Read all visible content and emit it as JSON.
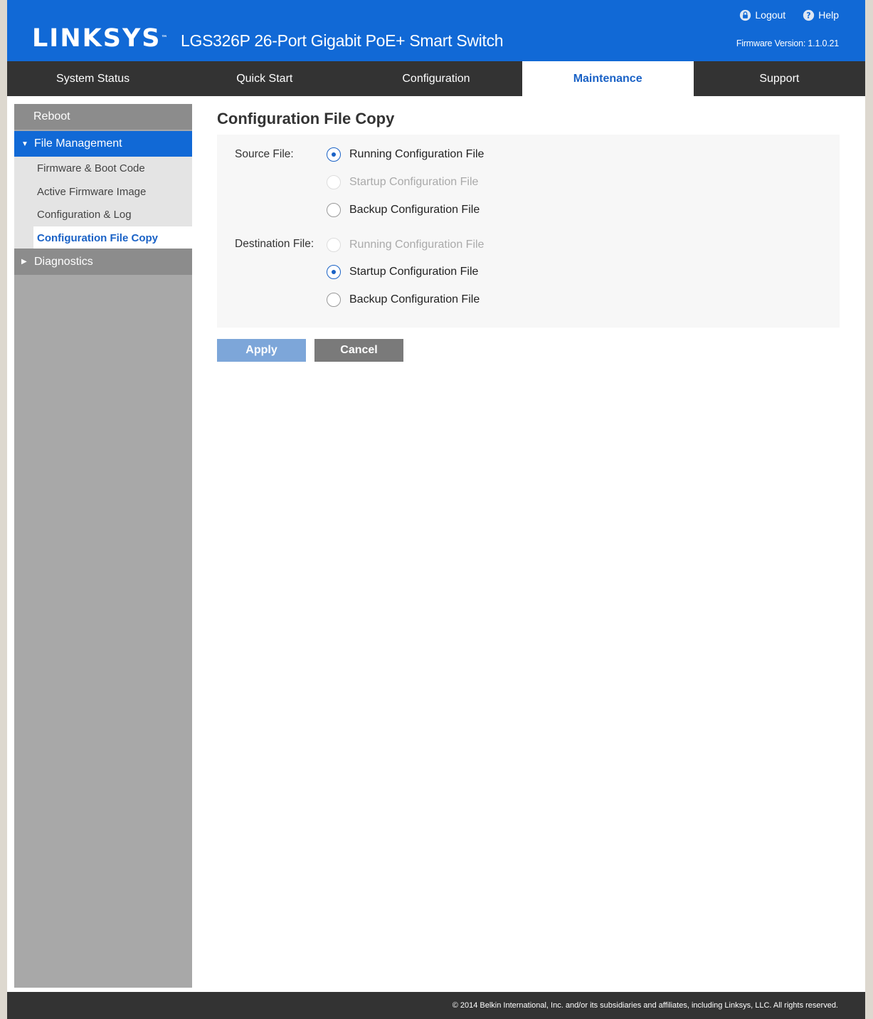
{
  "header": {
    "brand": "LINKSYS",
    "product_title": "LGS326P 26-Port Gigabit PoE+ Smart Switch",
    "logout_label": "Logout",
    "help_label": "Help",
    "firmware_label": "Firmware Version: 1.1.0.21"
  },
  "topnav": {
    "items": [
      {
        "label": "System Status"
      },
      {
        "label": "Quick Start"
      },
      {
        "label": "Configuration"
      },
      {
        "label": "Maintenance"
      },
      {
        "label": "Support"
      }
    ],
    "active": "Maintenance"
  },
  "sidebar": {
    "reboot": "Reboot",
    "file_management": "File Management",
    "sub_items": [
      {
        "label": "Firmware & Boot Code"
      },
      {
        "label": "Active Firmware Image"
      },
      {
        "label": "Configuration & Log"
      },
      {
        "label": "Configuration File Copy"
      }
    ],
    "active": "Configuration File Copy",
    "diagnostics": "Diagnostics"
  },
  "main": {
    "title": "Configuration File Copy",
    "source": {
      "label": "Source File:",
      "options": [
        {
          "label": "Running Configuration File",
          "checked": true,
          "disabled": false
        },
        {
          "label": "Startup Configuration File",
          "checked": false,
          "disabled": true
        },
        {
          "label": "Backup Configuration File",
          "checked": false,
          "disabled": false
        }
      ]
    },
    "destination": {
      "label": "Destination File:",
      "options": [
        {
          "label": "Running Configuration File",
          "checked": false,
          "disabled": true
        },
        {
          "label": "Startup Configuration File",
          "checked": true,
          "disabled": false
        },
        {
          "label": "Backup Configuration File",
          "checked": false,
          "disabled": false
        }
      ]
    },
    "apply_label": "Apply",
    "cancel_label": "Cancel"
  },
  "footer": {
    "copyright": "© 2014 Belkin International, Inc. and/or its subsidiaries and affiliates, including Linksys, LLC. All rights reserved."
  },
  "icons": {
    "logout": "lock-icon",
    "help": "help-circle-icon",
    "expanded": "triangle-down-icon",
    "collapsed": "triangle-right-icon"
  },
  "colors": {
    "brand_blue": "#1169d6",
    "nav_dark": "#333333",
    "active_text": "#1a62c6",
    "sidebar_gray": "#a8a8a8",
    "apply_button": "#7da6d9",
    "cancel_button": "#7a7a7a"
  }
}
